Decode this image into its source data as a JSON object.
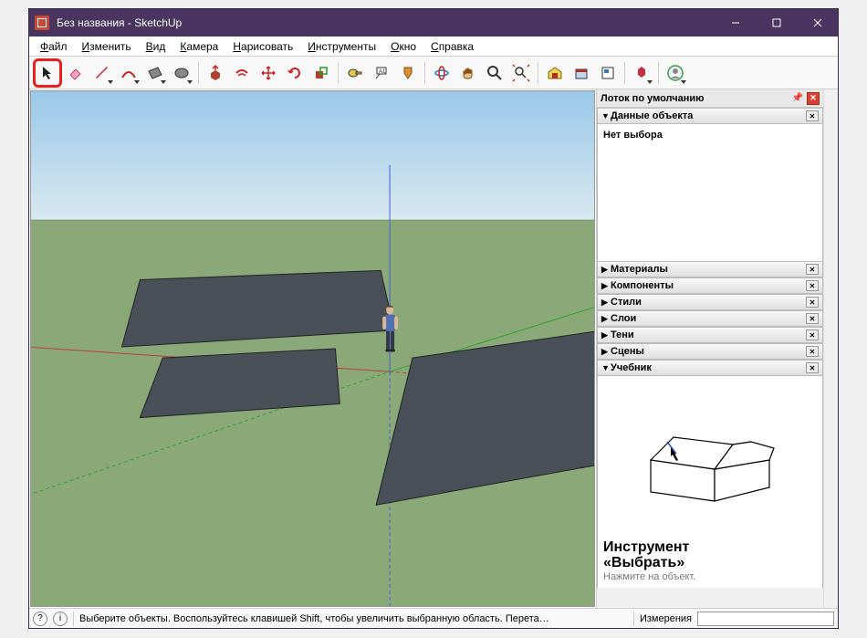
{
  "titlebar": {
    "text": "Без названия - SketchUp"
  },
  "menus": [
    "Файл",
    "Изменить",
    "Вид",
    "Камера",
    "Нарисовать",
    "Инструменты",
    "Окно",
    "Справка"
  ],
  "tray": {
    "title": "Лоток по умолчанию",
    "entity": {
      "label": "Данные объекта",
      "noSelection": "Нет выбора"
    },
    "sections": [
      "Материалы",
      "Компоненты",
      "Стили",
      "Слои",
      "Тени",
      "Сцены"
    ],
    "instructor": {
      "label": "Учебник",
      "title1": "Инструмент",
      "title2": "«Выбрать»",
      "sub": "Нажмите на объект."
    }
  },
  "status": {
    "hint": "Выберите объекты. Воспользуйтесь клавишей Shift, чтобы увеличить выбранную область. Перета…",
    "measureLabel": "Измерения"
  }
}
